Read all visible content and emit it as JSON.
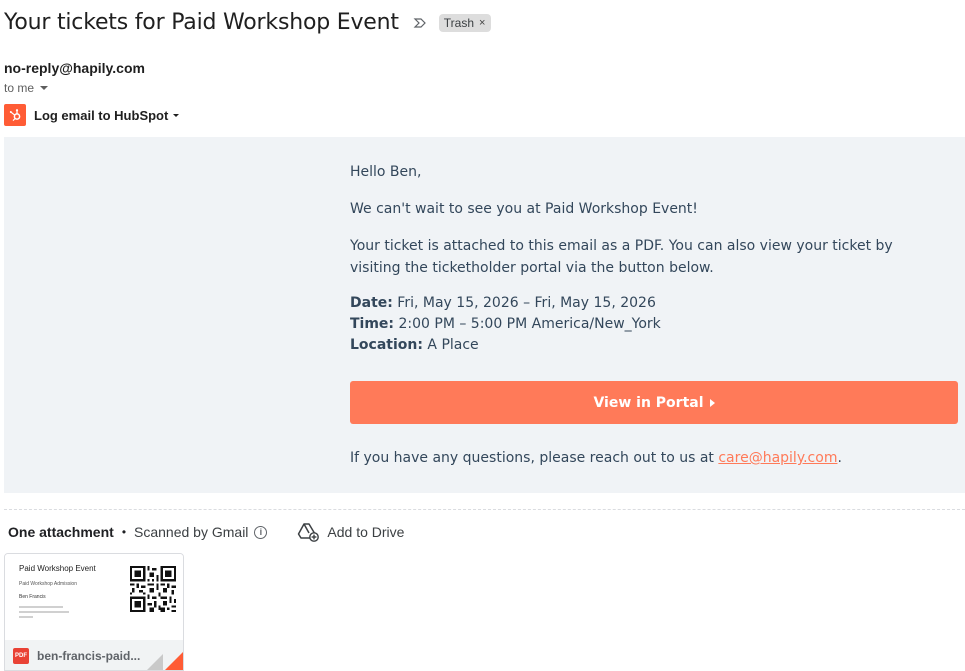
{
  "email": {
    "subject": "Your tickets for Paid Workshop Event",
    "label": "Trash",
    "label_close": "×",
    "sender": "no-reply@hapily.com",
    "to": "to me"
  },
  "hubspot": {
    "label": "Log email to HubSpot",
    "brand_color": "#ff5c35"
  },
  "body": {
    "greeting": "Hello Ben,",
    "intro": "We can't wait to see you at Paid Workshop Event!",
    "ticket_info": "Your ticket is attached to this email as a PDF. You can also view your ticket by visiting the ticketholder portal via the button below.",
    "date_label": "Date:",
    "date_value": " Fri, May 15, 2026 – Fri, May 15, 2026",
    "time_label": "Time:",
    "time_value": " 2:00 PM – 5:00 PM America/New_York",
    "location_label": "Location:",
    "location_value": " A Place",
    "button_label": "View in Portal",
    "button_color": "#ff7a59",
    "questions_text": "If you have any questions, please reach out to us at ",
    "contact_email": "care@hapily.com",
    "questions_end": "."
  },
  "attachments": {
    "title": "One attachment",
    "separator": "•",
    "scanned": "Scanned by Gmail",
    "info_glyph": "i",
    "add_to_drive": "Add to Drive",
    "file": {
      "name": "ben-francis-paid...",
      "type_badge": "PDF",
      "preview_title": "Paid Workshop Event",
      "preview_sub": "Paid Workshop Admission",
      "preview_name": "Ben Francis"
    }
  },
  "icons": {
    "importance": "importance-marker-icon",
    "hubspot": "hubspot-sprocket-icon",
    "info": "info-icon",
    "drive": "add-to-drive-icon",
    "pdf": "pdf-icon"
  }
}
